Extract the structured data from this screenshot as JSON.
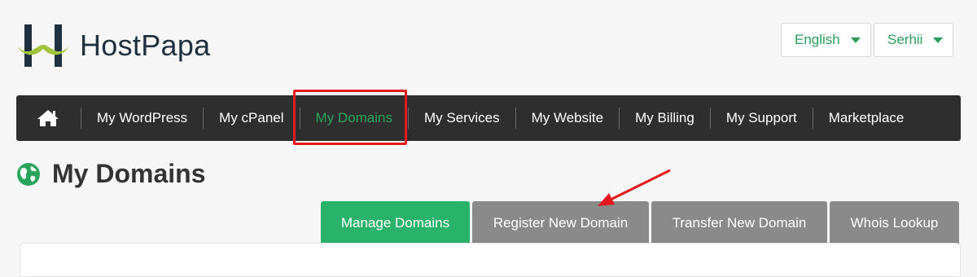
{
  "header": {
    "brand": "HostPapa",
    "language": "English",
    "user": "Serhii"
  },
  "nav": {
    "items": [
      {
        "label": "My WordPress"
      },
      {
        "label": "My cPanel"
      },
      {
        "label": "My Domains"
      },
      {
        "label": "My Services"
      },
      {
        "label": "My Website"
      },
      {
        "label": "My Billing"
      },
      {
        "label": "My Support"
      },
      {
        "label": "Marketplace"
      }
    ],
    "active_index": 2,
    "icons": {
      "home": "home-icon"
    }
  },
  "page": {
    "title": "My Domains",
    "title_icon": "globe-icon"
  },
  "tabs": [
    {
      "label": "Manage Domains",
      "active": true
    },
    {
      "label": "Register New Domain",
      "active": false
    },
    {
      "label": "Transfer New Domain",
      "active": false
    },
    {
      "label": "Whois Lookup",
      "active": false
    }
  ],
  "colors": {
    "accent_green": "#29b36a",
    "nav_bg": "#2e2e2e",
    "highlight_red": "#e3191e",
    "tab_inactive": "#8a8a8a"
  }
}
